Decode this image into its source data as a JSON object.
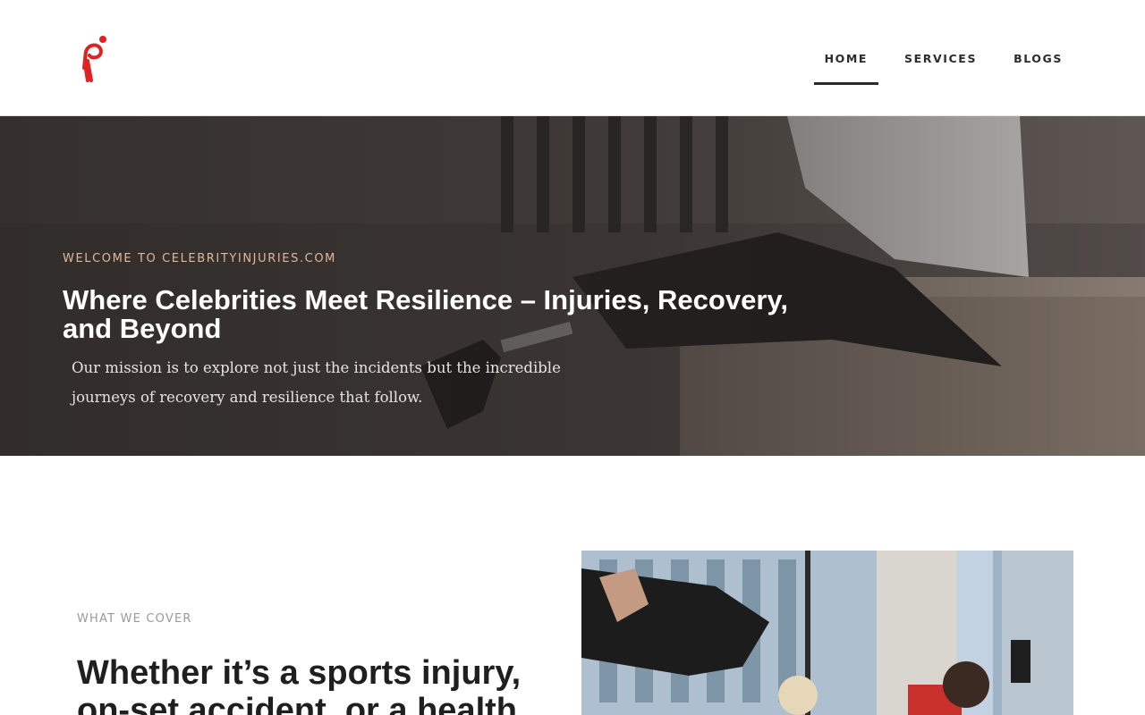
{
  "header": {
    "logo_name": "brand-logo",
    "nav": [
      {
        "label": "HOME",
        "active": true
      },
      {
        "label": "SERVICES",
        "active": false
      },
      {
        "label": "BLOGS",
        "active": false
      }
    ]
  },
  "hero": {
    "eyebrow": "WELCOME TO CELEBRITYINJURIES.COM",
    "title": "Where Celebrities Meet Resilience – Injuries, Recovery, and Beyond",
    "description": "Our mission is to explore not just the incidents but the incredible journeys of recovery and resilience that follow."
  },
  "cover": {
    "eyebrow": "WHAT WE COVER",
    "title": "Whether it’s a sports injury, on-set accident, or a health"
  },
  "colors": {
    "accent": "#e02222",
    "eyebrow_hero": "#e0b79a",
    "text_dark": "#1f1f1f"
  }
}
